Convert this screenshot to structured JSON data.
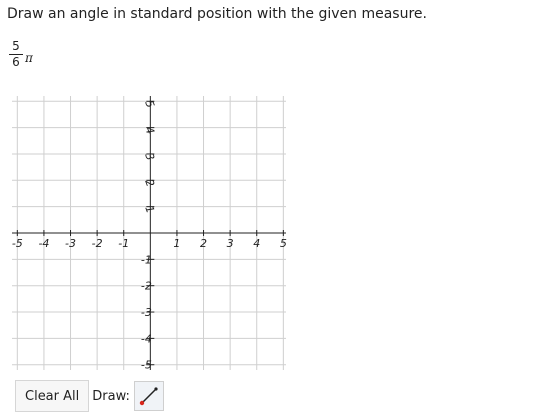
{
  "prompt": "Draw an angle in standard position with the given measure.",
  "measure": {
    "numerator": "5",
    "denominator": "6",
    "symbol": "π"
  },
  "graph": {
    "x_range": [
      -5,
      5
    ],
    "y_range": [
      -5,
      5
    ],
    "grid": true,
    "x_ticks": [
      "-5",
      "-4",
      "-3",
      "-2",
      "-1",
      "1",
      "2",
      "3",
      "4",
      "5"
    ],
    "y_ticks_positive": [
      "5",
      "4",
      "3",
      "2",
      "1"
    ],
    "y_ticks_negative": [
      "-1",
      "-2",
      "-3",
      "-4",
      "-5"
    ]
  },
  "toolbar": {
    "clear_label": "Clear All",
    "draw_label": "Draw:",
    "tool_icon": "line-segment-icon"
  },
  "colors": {
    "grid": "#cfcfcf",
    "axis": "#222222",
    "tool_accent": "#d9261c"
  }
}
